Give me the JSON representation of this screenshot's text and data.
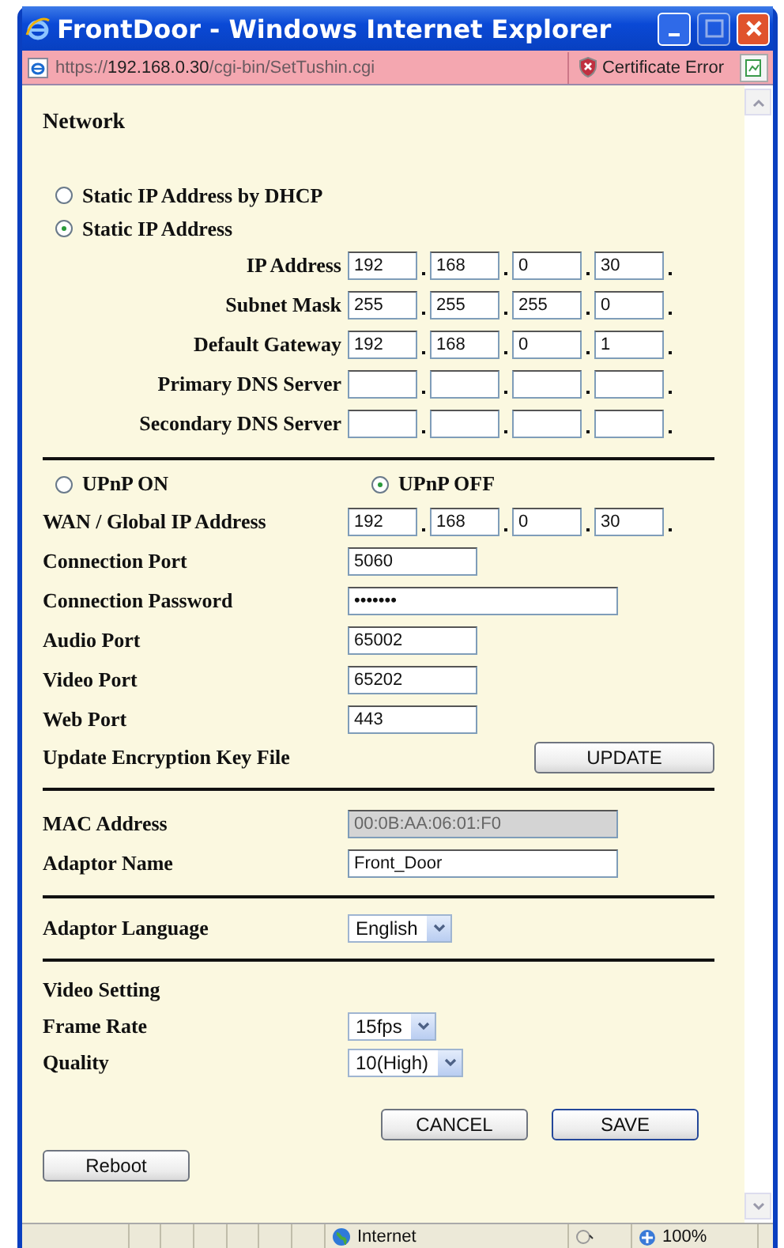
{
  "window": {
    "title": "FrontDoor - Windows Internet Explorer"
  },
  "address_bar": {
    "scheme": "https://",
    "host": "192.168.0.30",
    "path": "/cgi-bin/SetTushin.cgi",
    "certificate_error": "Certificate Error"
  },
  "network": {
    "heading": "Network",
    "ip_modes": [
      {
        "label": "Static IP Address by DHCP",
        "selected": false
      },
      {
        "label": "Static IP Address",
        "selected": true
      }
    ],
    "ip_rows": [
      {
        "label": "IP Address",
        "octets": [
          "192",
          "168",
          "0",
          "30"
        ]
      },
      {
        "label": "Subnet Mask",
        "octets": [
          "255",
          "255",
          "255",
          "0"
        ]
      },
      {
        "label": "Default Gateway",
        "octets": [
          "192",
          "168",
          "0",
          "1"
        ]
      },
      {
        "label": "Primary DNS Server"
      },
      {
        "label": "Secondary DNS Server"
      }
    ]
  },
  "upnp": {
    "options": [
      {
        "label": "UPnP ON",
        "selected": false
      },
      {
        "label": "UPnP OFF",
        "selected": true
      }
    ],
    "wan": {
      "label": "WAN / Global IP Address",
      "octets": [
        "192",
        "168",
        "0",
        "30"
      ]
    },
    "rows": [
      {
        "kind": "text",
        "label": "Connection Port",
        "value": "5060"
      },
      {
        "kind": "password",
        "label": "Connection Password",
        "value": "•••••••"
      },
      {
        "kind": "text",
        "label": "Audio Port",
        "value": "65002"
      },
      {
        "kind": "text",
        "label": "Video Port",
        "value": "65202"
      },
      {
        "kind": "text",
        "label": "Web Port",
        "value": "443"
      },
      {
        "kind": "button",
        "label": "Update Encryption Key File",
        "value": "UPDATE"
      }
    ]
  },
  "adaptor": {
    "mac": {
      "label": "MAC Address",
      "value": "00:0B:AA:06:01:F0",
      "disabled": true
    },
    "name": {
      "label": "Adaptor Name",
      "value": "Front_Door",
      "disabled": false
    }
  },
  "language": {
    "label": "Adaptor Language",
    "value": "English"
  },
  "video": {
    "heading": "Video Setting",
    "selects": [
      {
        "label": "Frame Rate",
        "value": "15fps"
      },
      {
        "label": "Quality",
        "value": "10(High)"
      }
    ]
  },
  "buttons": {
    "cancel": "CANCEL",
    "save": "SAVE",
    "reboot": "Reboot"
  },
  "status_bar": {
    "zone": "Internet",
    "zoom": "100%"
  }
}
